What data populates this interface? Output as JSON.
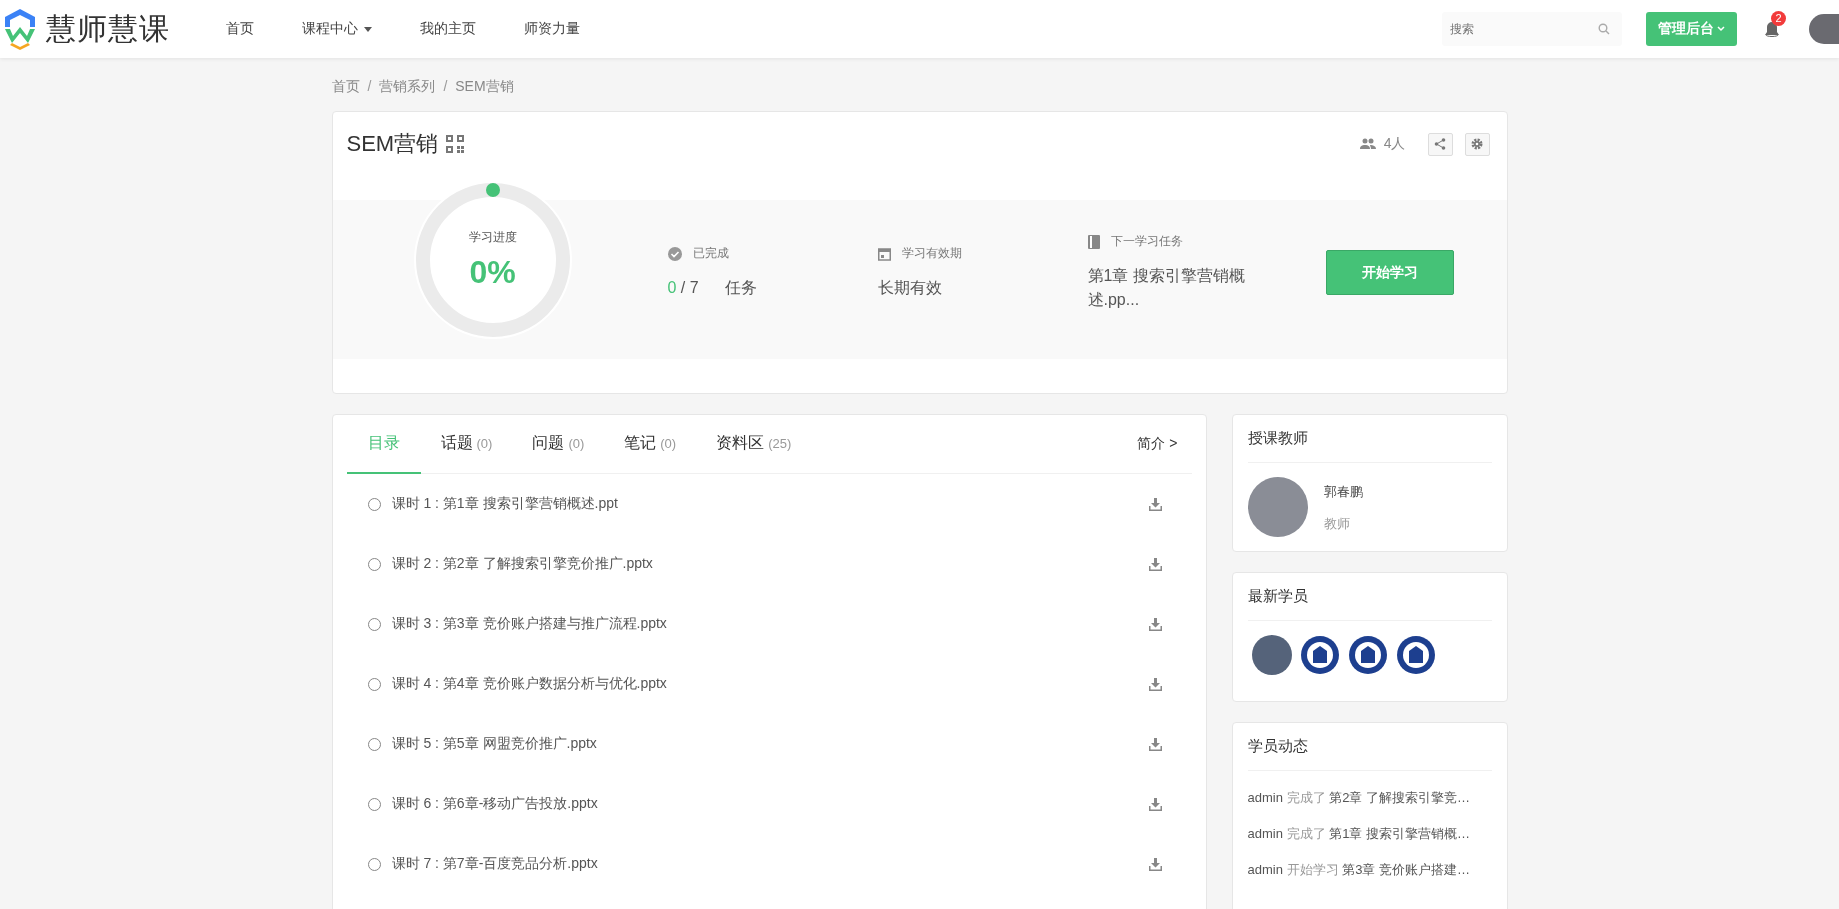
{
  "header": {
    "logo_text": "慧师慧课",
    "nav": [
      {
        "label": "首页",
        "dropdown": false
      },
      {
        "label": "课程中心",
        "dropdown": true
      },
      {
        "label": "我的主页",
        "dropdown": false
      },
      {
        "label": "师资力量",
        "dropdown": false
      }
    ],
    "search": {
      "placeholder": "搜索"
    },
    "admin_button": "管理后台",
    "notification_count": "2"
  },
  "breadcrumb": {
    "separator": "/",
    "items": [
      "首页",
      "营销系列",
      "SEM营销"
    ]
  },
  "course": {
    "title": "SEM营销",
    "members": "4人",
    "progress": {
      "label": "学习进度",
      "value": "0%",
      "level": 0
    },
    "stats": [
      {
        "kind": "completed",
        "label": "已完成",
        "done": "0",
        "separator": "/",
        "total": "7",
        "unit": "任务"
      },
      {
        "kind": "validity",
        "label": "学习有效期",
        "value": "长期有效"
      },
      {
        "kind": "next",
        "label": "下一学习任务",
        "value": "第1章 搜索引擎营销概述.pp..."
      }
    ],
    "start_button": "开始学习"
  },
  "tabs": [
    {
      "label": "目录",
      "selected": true
    },
    {
      "label": "话题",
      "count": "(0)",
      "selected": false
    },
    {
      "label": "问题",
      "count": "(0)",
      "selected": false
    },
    {
      "label": "笔记",
      "count": "(0)",
      "selected": false
    },
    {
      "label": "资料区",
      "count": "(25)",
      "selected": false
    }
  ],
  "intro_link": "简介 >",
  "lessons": [
    {
      "text": "课时 1 : 第1章 搜索引擎营销概述.ppt",
      "completed": false
    },
    {
      "text": "课时 2 : 第2章 了解搜索引擎竞价推广.pptx",
      "completed": false
    },
    {
      "text": "课时 3 : 第3章 竞价账户搭建与推广流程.pptx",
      "completed": false
    },
    {
      "text": "课时 4 : 第4章 竞价账户数据分析与优化.pptx",
      "completed": false
    },
    {
      "text": "课时 5 : 第5章 网盟竞价推广.pptx",
      "completed": false
    },
    {
      "text": "课时 6 : 第6章-移动广告投放.pptx",
      "completed": false
    },
    {
      "text": "课时 7 : 第7章-百度竞品分析.pptx",
      "completed": false
    }
  ],
  "teacher": {
    "heading": "授课教师",
    "name": "郭春鹏",
    "role": "教师"
  },
  "students": {
    "heading": "最新学员",
    "avatars": [
      {
        "kind": "photo"
      },
      {
        "kind": "emblem"
      },
      {
        "kind": "emblem"
      },
      {
        "kind": "emblem"
      }
    ]
  },
  "activity": {
    "heading": "学员动态",
    "items": [
      {
        "user": "admin",
        "action": "完成了",
        "title": "第2章 了解搜索引擎竞…"
      },
      {
        "user": "admin",
        "action": "完成了",
        "title": "第1章 搜索引擎营销概…"
      },
      {
        "user": "admin",
        "action": "开始学习",
        "title": "第3章 竞价账户搭建…"
      }
    ]
  }
}
